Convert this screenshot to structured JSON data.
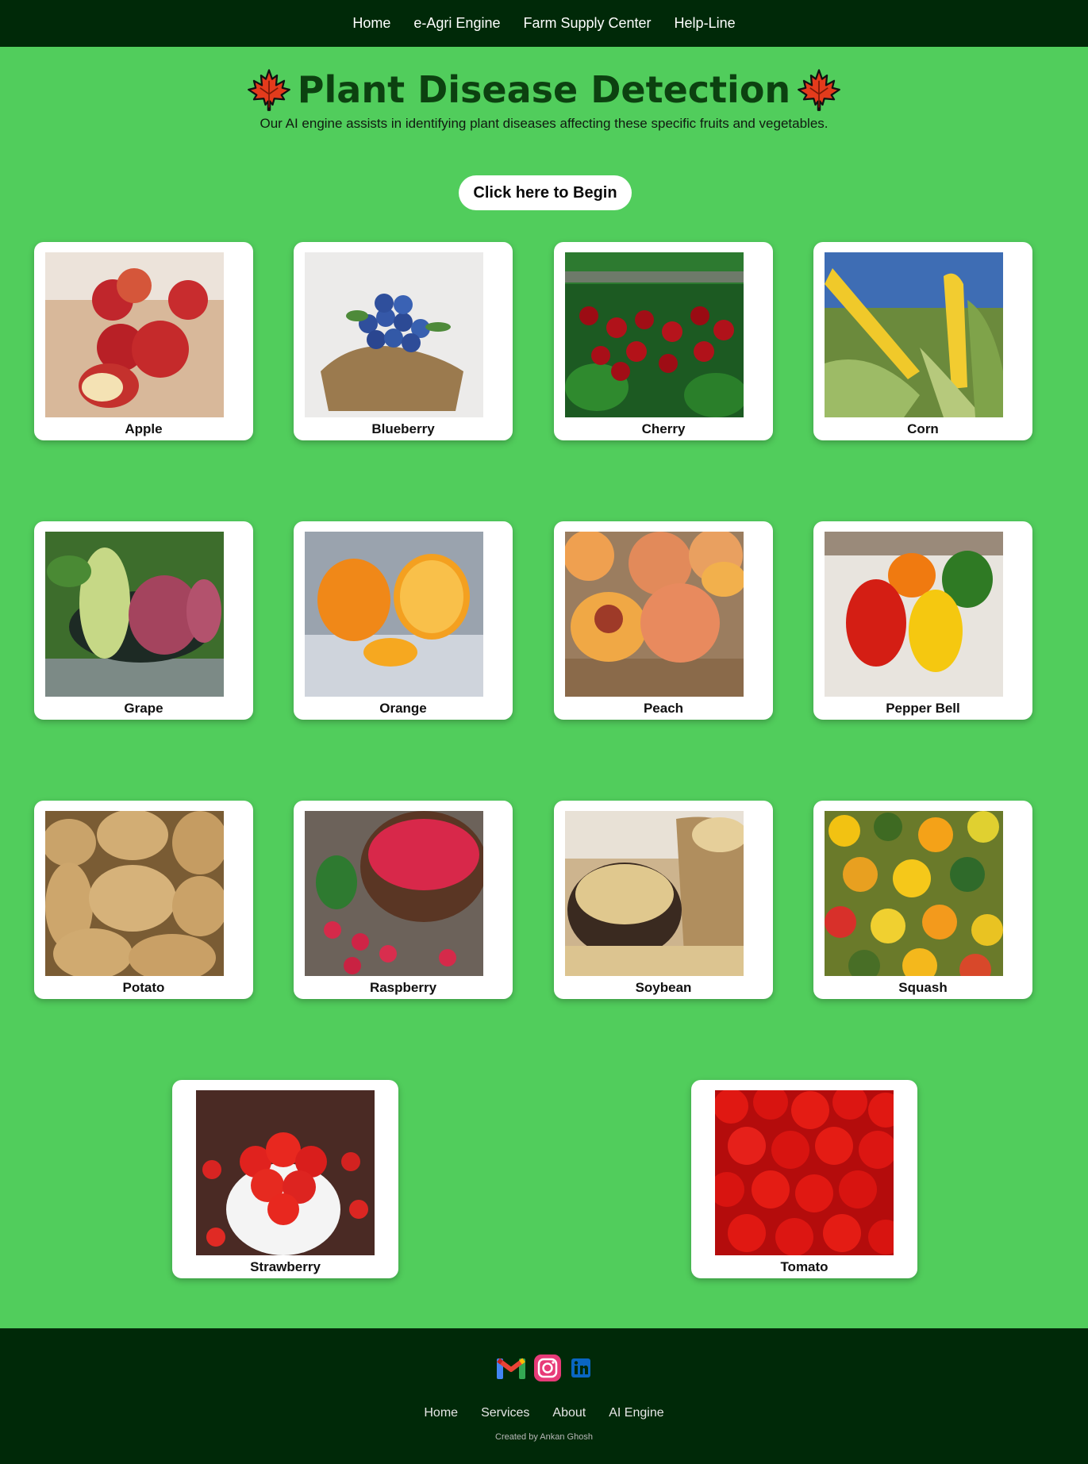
{
  "nav": {
    "items": [
      {
        "label": "Home"
      },
      {
        "label": "e-Agri Engine"
      },
      {
        "label": "Farm Supply Center"
      },
      {
        "label": "Help-Line"
      }
    ]
  },
  "header": {
    "title": "Plant Disease Detection",
    "icon": "maple-leaf-icon",
    "subtitle": "Our AI engine assists in identifying plant diseases affecting these specific fruits and vegetables."
  },
  "cta": {
    "label": "Click here to Begin"
  },
  "crops": [
    {
      "name": "Apple"
    },
    {
      "name": "Blueberry"
    },
    {
      "name": "Cherry"
    },
    {
      "name": "Corn"
    },
    {
      "name": "Grape"
    },
    {
      "name": "Orange"
    },
    {
      "name": "Peach"
    },
    {
      "name": "Pepper Bell"
    },
    {
      "name": "Potato"
    },
    {
      "name": "Raspberry"
    },
    {
      "name": "Soybean"
    },
    {
      "name": "Squash"
    },
    {
      "name": "Strawberry"
    },
    {
      "name": "Tomato"
    }
  ],
  "footer": {
    "social": [
      {
        "icon": "gmail-icon"
      },
      {
        "icon": "instagram-icon"
      },
      {
        "icon": "linkedin-icon"
      }
    ],
    "links": [
      {
        "label": "Home"
      },
      {
        "label": "Services"
      },
      {
        "label": "About"
      },
      {
        "label": "AI Engine"
      }
    ],
    "credit": "Created by Ankan Ghosh"
  },
  "colors": {
    "page_background": "#51cd5c",
    "nav_background": "#002908",
    "title_color": "#0c4110",
    "card_background": "#ffffff"
  }
}
